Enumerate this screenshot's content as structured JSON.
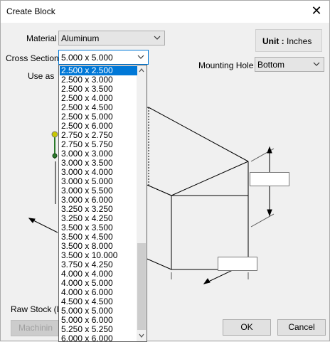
{
  "window": {
    "title": "Create Block"
  },
  "material": {
    "label": "Material",
    "value": "Aluminum"
  },
  "cross_section": {
    "label": "Cross Section",
    "value": "5.000 x 5.000"
  },
  "use_as": {
    "label": "Use as"
  },
  "unit": {
    "label": "Unit :",
    "value": "Inches"
  },
  "mounting_hole": {
    "label": "Mounting Hole",
    "value": "Bottom"
  },
  "raw_stock": {
    "label": "Raw Stock (L"
  },
  "buttons": {
    "machining": "Machinin",
    "ok": "OK",
    "cancel": "Cancel"
  },
  "dropdown": {
    "selected_index": 0,
    "options": [
      "2.500 x 2.500",
      "2.500 x 3.000",
      "2.500 x 3.500",
      "2.500 x 4.000",
      "2.500 x 4.500",
      "2.500 x 5.000",
      "2.500 x 6.000",
      "2.750 x 2.750",
      "2.750 x 5.750",
      "3.000 x 3.000",
      "3.000 x 3.500",
      "3.000 x 4.000",
      "3.000 x 5.000",
      "3.000 x 5.500",
      "3.000 x 6.000",
      "3.250 x 3.250",
      "3.250 x 4.250",
      "3.500 x 3.500",
      "3.500 x 4.500",
      "3.500 x 8.000",
      "3.500 x 10.000",
      "3.750 x 4.250",
      "4.000 x 4.000",
      "4.000 x 5.000",
      "4.000 x 6.000",
      "4.500 x 4.500",
      "5.000 x 5.000",
      "5.000 x 6.000",
      "5.250 x 5.250",
      "6.000 x 6.000"
    ]
  },
  "icons": {
    "close": "close-icon",
    "chevron": "chevron-down-icon",
    "scroll_up": "scroll-up-arrow-icon",
    "scroll_down": "scroll-down-arrow-icon"
  }
}
